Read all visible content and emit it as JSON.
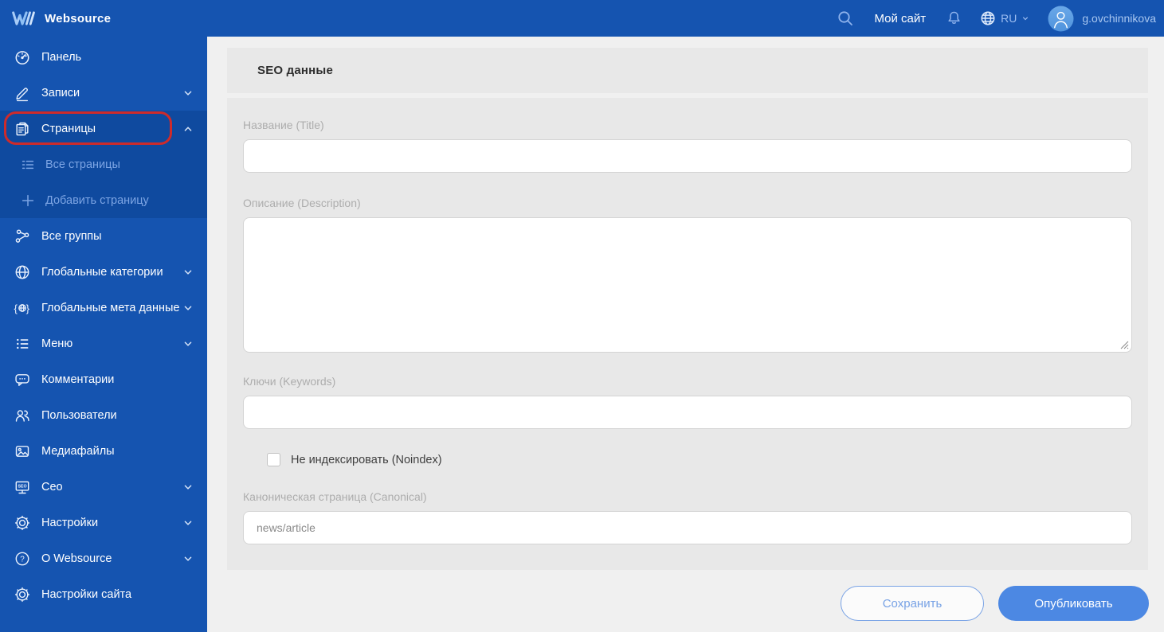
{
  "topbar": {
    "brand": "Websource",
    "my_site_label": "Мой сайт",
    "language": "RU",
    "username": "g.ovchinnikova"
  },
  "sidebar": {
    "items": [
      {
        "label": "Панель",
        "icon": "dashboard-icon"
      },
      {
        "label": "Записи",
        "icon": "pencil-icon",
        "chevron": "down"
      },
      {
        "label": "Страницы",
        "icon": "pages-icon",
        "chevron": "up",
        "expanded": true,
        "annotated_red": true
      },
      {
        "label": "Все страницы",
        "icon": "list-icon",
        "sub": true
      },
      {
        "label": "Добавить страницу",
        "icon": "plus-icon",
        "sub": true
      },
      {
        "label": "Все группы",
        "icon": "nodes-icon"
      },
      {
        "label": "Глобальные категории",
        "icon": "globe-icon",
        "chevron": "down"
      },
      {
        "label": "Глобальные мета данные",
        "icon": "meta-braces-globe-icon",
        "chevron": "down"
      },
      {
        "label": "Меню",
        "icon": "menu-list-icon",
        "chevron": "down"
      },
      {
        "label": "Комментарии",
        "icon": "comments-icon"
      },
      {
        "label": "Пользователи",
        "icon": "users-icon"
      },
      {
        "label": "Медиафайлы",
        "icon": "media-image-icon"
      },
      {
        "label": "Сео",
        "icon": "seo-monitor-icon",
        "chevron": "down"
      },
      {
        "label": "Настройки",
        "icon": "gear-icon",
        "chevron": "down"
      },
      {
        "label": "О Websource",
        "icon": "question-icon",
        "chevron": "down"
      },
      {
        "label": "Настройки сайта",
        "icon": "gear-icon"
      }
    ]
  },
  "panel": {
    "title": "SEO данные",
    "fields": {
      "title": {
        "label": "Название (Title)",
        "value": ""
      },
      "description": {
        "label": "Описание (Description)",
        "value": ""
      },
      "keywords": {
        "label": "Ключи (Keywords)",
        "value": ""
      },
      "noindex": {
        "label": "Не индексировать (Noindex)",
        "checked": false
      },
      "canonical": {
        "label": "Каноническая страница (Canonical)",
        "value": "news/article"
      }
    }
  },
  "actions": {
    "save": "Сохранить",
    "publish": "Опубликовать"
  },
  "icons": {
    "topbar": [
      "websource-logo",
      "search-icon",
      "bell-icon",
      "globe-icon",
      "chevron-down-icon",
      "avatar-icon"
    ],
    "misc": [
      "resize-grip-icon",
      "red-annotation-box"
    ]
  },
  "colors": {
    "sidebar_blue": "#1554b0",
    "expanded_group_blue": "#0f4a9f",
    "annotation_red": "#ce2b2b",
    "panel_gray": "#e8e8e8",
    "page_bg": "#f0f0f0",
    "accent_light_blue": "#7da5e4",
    "publish_blue": "#4c88e3",
    "save_outline_blue": "#78a2e5"
  }
}
